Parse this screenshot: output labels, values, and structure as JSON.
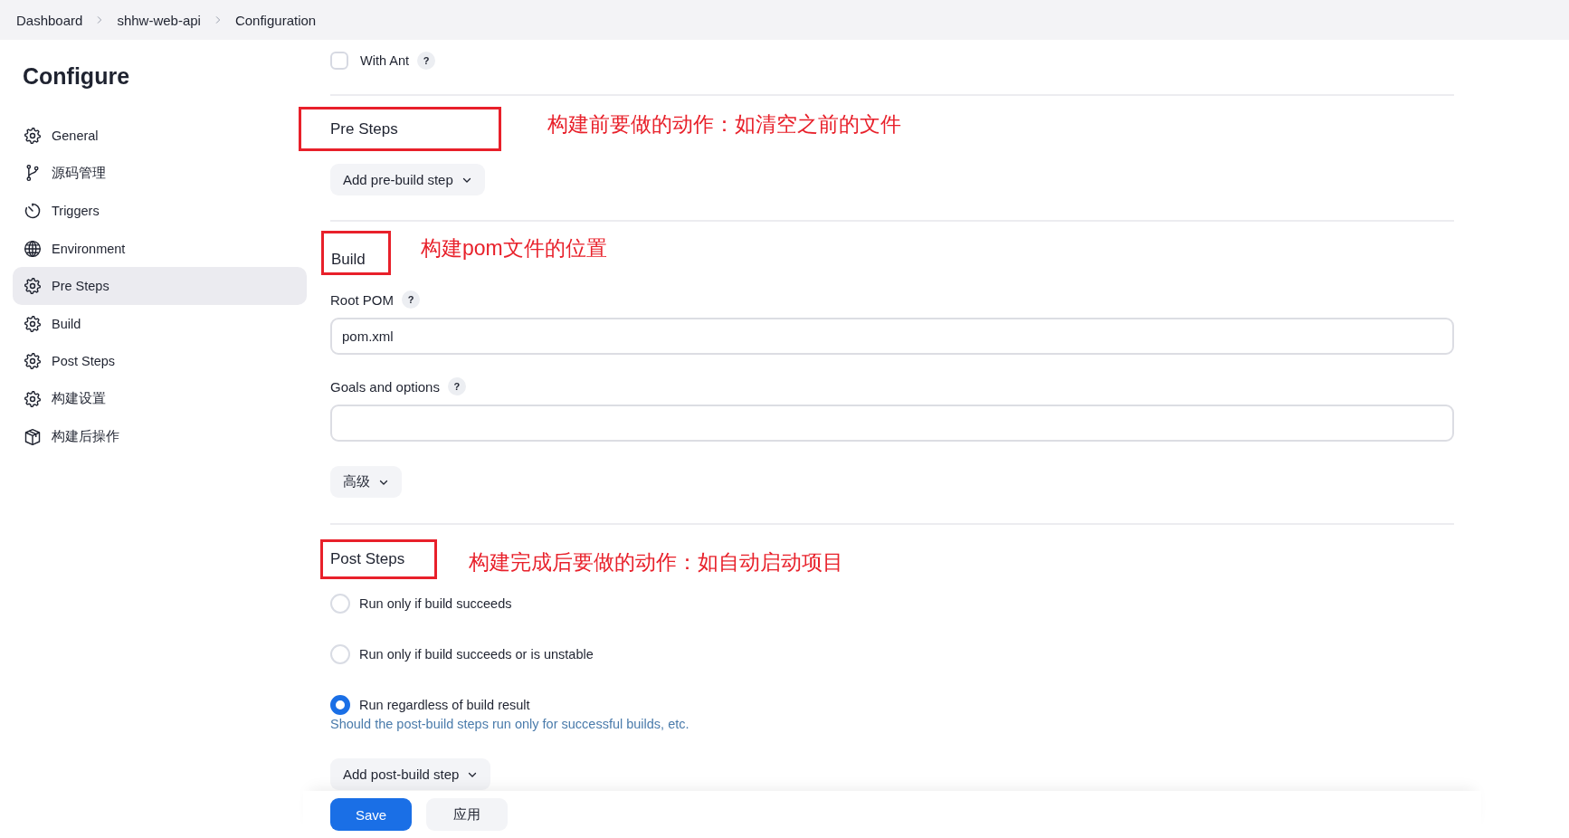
{
  "breadcrumb": [
    "Dashboard",
    "shhw-web-api",
    "Configuration"
  ],
  "sidebar": {
    "title": "Configure",
    "items": [
      {
        "label": "General",
        "kind": "gear",
        "selected": false
      },
      {
        "label": "源码管理",
        "kind": "branch",
        "selected": false
      },
      {
        "label": "Triggers",
        "kind": "timer",
        "selected": false
      },
      {
        "label": "Environment",
        "kind": "globe",
        "selected": false
      },
      {
        "label": "Pre Steps",
        "kind": "gear",
        "selected": true
      },
      {
        "label": "Build",
        "kind": "gear",
        "selected": false
      },
      {
        "label": "Post Steps",
        "kind": "gear",
        "selected": false
      },
      {
        "label": "构建设置",
        "kind": "gear",
        "selected": false
      },
      {
        "label": "构建后操作",
        "kind": "package",
        "selected": false
      }
    ]
  },
  "with_ant": {
    "label": "With Ant",
    "checked": false,
    "help": "?"
  },
  "pre_steps": {
    "heading": "Pre Steps",
    "annotation": "构建前要做的动作：如清空之前的文件",
    "button": "Add pre-build step"
  },
  "build": {
    "heading": "Build",
    "annotation": "构建pom文件的位置",
    "fields": [
      {
        "label": "Root POM",
        "help": "?",
        "value": "pom.xml"
      },
      {
        "label": "Goals and options",
        "help": "?"
      }
    ],
    "advanced_button": "高级"
  },
  "post_steps": {
    "heading": "Post Steps",
    "annotation": "构建完成后要做的动作：如自动启动项目",
    "options": [
      {
        "label": "Run only if build succeeds",
        "selected": false
      },
      {
        "label": "Run only if build succeeds or is unstable",
        "selected": false
      },
      {
        "label": "Run regardless of build result",
        "selected": true
      }
    ],
    "hint": "Should the post-build steps run only for successful builds, etc.",
    "button": "Add post-build step"
  },
  "footer": {
    "buttons": [
      {
        "label": "Save",
        "kind": "primary"
      },
      {
        "label": "应用",
        "kind": "secondary"
      }
    ]
  }
}
